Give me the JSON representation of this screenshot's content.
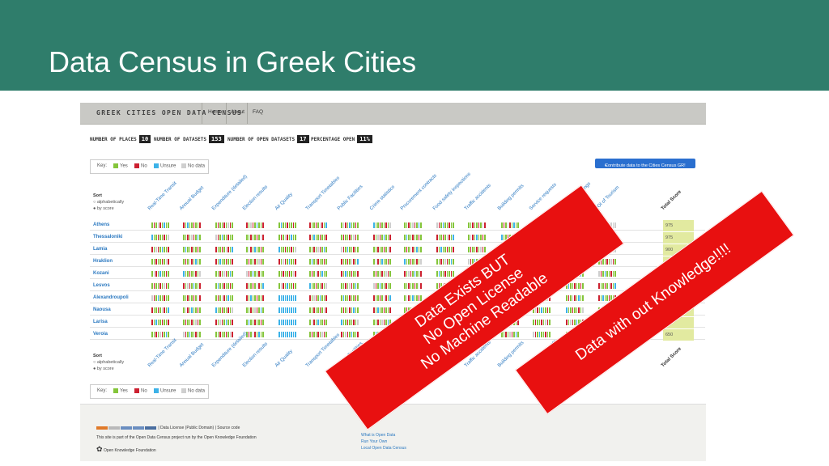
{
  "slide": {
    "title": "Data Census in Greek Cities"
  },
  "topbar": {
    "brand": "GREEK CITIES OPEN DATA CENSUS",
    "nav": [
      "Home",
      "About",
      "FAQ"
    ]
  },
  "stats": [
    {
      "label": "NUMBER OF PLACES",
      "value": "10"
    },
    {
      "label": "NUMBER OF DATASETS",
      "value": "153"
    },
    {
      "label": "NUMBER OF OPEN DATASETS",
      "value": "17"
    },
    {
      "label": "PERCENTAGE OPEN",
      "value": "11%"
    }
  ],
  "key": {
    "title": "Key:",
    "items": [
      "Yes",
      "No",
      "Unsure",
      "No data"
    ]
  },
  "contribute_button": "Contribute data to the Cities Census GR!",
  "sort": {
    "title": "Sort",
    "options": [
      "alphabetically",
      "by score"
    ]
  },
  "columns": [
    "Real-Time Transit",
    "Annual Budget",
    "Expenditure (detailed)",
    "Election results",
    "Air Quality",
    "Transport Timetables",
    "Public Facilities",
    "Crime statistics",
    "Procurement contracts",
    "Food safety inspections",
    "Traffic accidents",
    "Building permits",
    "Service requests",
    "Business Listings",
    "POI of Tourism",
    "Total Score"
  ],
  "cities": [
    "Athens",
    "Thessaloniki",
    "Lamia",
    "Hraklion",
    "Kozani",
    "Lesvos",
    "Alexandroupoli",
    "Naousa",
    "Larisa",
    "Veroia"
  ],
  "scores": [
    "975",
    "975",
    "900",
    "",
    "",
    "",
    "",
    "",
    "675",
    "650"
  ],
  "colors": {
    "yes": "#84c53a",
    "no": "#cc2030",
    "unsure": "#3cb2e8",
    "nodata": "#cfcfcf",
    "header": "#2f7d6b",
    "banner": "#e81010"
  },
  "footer": {
    "license": "| Data License (Public Domain) | Source code",
    "attribution": "This site is part of the Open Data Census project run by the Open Knowledge Foundation",
    "okf": "Open Knowledge Foundation",
    "links": [
      "What is Open Data",
      "Run Your Own",
      "Local Open Data Census"
    ]
  },
  "annotations": {
    "banner1": "Data Exists BUT\nNo Open License\nNo Machine Readable",
    "banner2": "Data with out Knowledge!!!!"
  }
}
